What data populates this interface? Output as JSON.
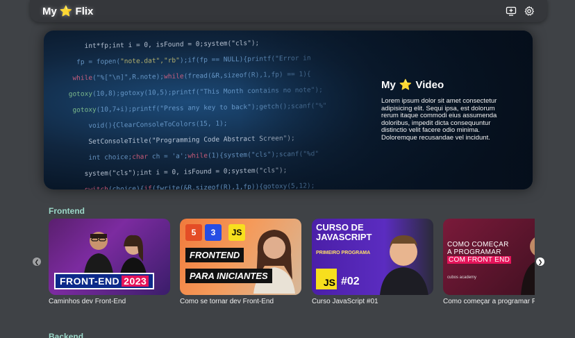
{
  "navbar": {
    "brand_left": "My",
    "brand_right": "Flix",
    "brand_icon": "star-emoji"
  },
  "hero": {
    "title_left": "My",
    "title_right": "Video",
    "description": "Lorem ipsum dolor sit amet consectetur adipisicing elit. Sequi ipsa, est dolorum rerum itaque commodi eius assumenda doloribus, impedit dicta consequuntur distinctio velit facere odio minima. Doloremque recusandae vel incidunt."
  },
  "sections": [
    {
      "title": "Frontend",
      "videos": [
        {
          "caption": "Caminhos dev Front-End",
          "thumb_label": "FRONT-END",
          "thumb_year": "2023"
        },
        {
          "caption": "Como se tornar dev Front-End",
          "thumb_line1": "FRONTEND",
          "thumb_line2": "PARA INICIANTES",
          "badge_html": "5",
          "badge_css": "3",
          "badge_js": "JS"
        },
        {
          "caption": "Curso JavaScript #01",
          "thumb_title_1": "CURSO DE",
          "thumb_title_2": "JAVASCRIPT",
          "thumb_sub": "PRIMEIRO PROGRAMA",
          "thumb_js": "JS",
          "thumb_num": "#02"
        },
        {
          "caption": "Como começar a programar Fro",
          "thumb_line1": "COMO COMEÇAR",
          "thumb_line2": "A PROGRAMAR",
          "thumb_line3": "COM FRONT END",
          "thumb_brand": "cubos academy"
        }
      ]
    },
    {
      "title": "Backend"
    }
  ],
  "colors": {
    "background": "#3f4246",
    "navbar": "#35373b",
    "section_title": "#9bd8c8",
    "star": "#f5c518"
  }
}
